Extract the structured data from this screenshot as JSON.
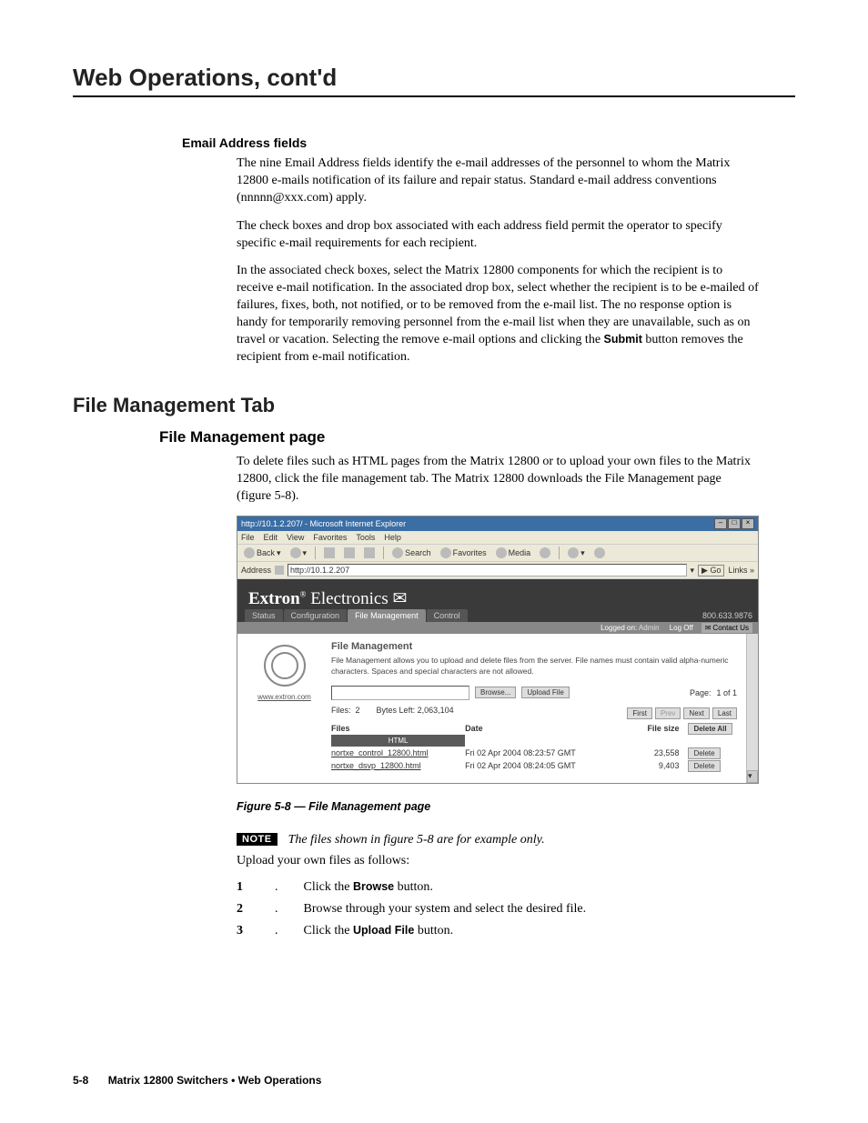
{
  "header": "Web Operations, cont'd",
  "sections": {
    "email_heading": "Email Address fields",
    "email_p1": "The nine Email Address fields identify the e-mail addresses of the personnel to whom the Matrix 12800 e-mails notification of its failure and repair status. Standard e-mail address conventions (nnnnn@xxx.com) apply.",
    "email_p2": "The check boxes and drop box associated with each address field permit the operator to specify specific e-mail requirements for each recipient.",
    "email_p3a": "In the associated check boxes, select the Matrix 12800 components for which the recipient is to receive e-mail notification.  In the associated drop box, select whether the recipient is to be e-mailed of failures, fixes, both, not notified, or to be removed from the e-mail list.  The no response option is handy for temporarily removing personnel from the e-mail list when they are unavailable, such as on travel or vacation.  Selecting the remove e-mail options and clicking the ",
    "email_p3_bold": "Submit",
    "email_p3b": " button removes the recipient from e-mail notification.",
    "fmt_h1": "File Management Tab",
    "fmp_h2": "File Management page",
    "fmp_p1": "To delete files such as HTML pages from the Matrix 12800 or to upload your own files to the Matrix 12800, click the file management tab.  The Matrix 12800 downloads the File Management page (figure 5-8)."
  },
  "screenshot": {
    "title": "http://10.1.2.207/ - Microsoft Internet Explorer",
    "menus": [
      "File",
      "Edit",
      "View",
      "Favorites",
      "Tools",
      "Help"
    ],
    "toolbar": {
      "back": "Back",
      "search": "Search",
      "favorites": "Favorites",
      "media": "Media"
    },
    "address_label": "Address",
    "address_value": "http://10.1.2.207",
    "go": "Go",
    "links": "Links",
    "brand": "Extron",
    "brand2": "Electronics",
    "tabs": [
      "Status",
      "Configuration",
      "File Management",
      "Control"
    ],
    "phone": "800.633.9876",
    "logged": "Logged on:",
    "logged_user": "Admin",
    "logoff": "Log Off",
    "contact": "Contact Us",
    "leftlink": "www.extron.com",
    "panel_title": "File Management",
    "panel_desc": "File Management allows you to upload and delete files from the server. File names must contain valid alpha-numeric characters. Spaces and special characters are not allowed.",
    "browse": "Browse...",
    "upload": "Upload File",
    "page_label": "Page:",
    "page_info": "1 of   1",
    "files_label": "Files:",
    "files_count": "2",
    "bytes_label": "Bytes Left:",
    "bytes_val": "2,063,104",
    "first": "First",
    "prev": "Prev",
    "next": "Next",
    "last": "Last",
    "cols": {
      "files": "Files",
      "date": "Date",
      "size": "File size"
    },
    "delete_all": "Delete All",
    "html_group": "HTML",
    "rows": [
      {
        "name": "nortxe_control_12800.html",
        "date": "Fri 02 Apr 2004 08:23:57 GMT",
        "size": "23,558",
        "del": "Delete"
      },
      {
        "name": "nortxe_dsvp_12800.html",
        "date": "Fri 02 Apr 2004 08:24:05 GMT",
        "size": "9,403",
        "del": "Delete"
      }
    ]
  },
  "caption": "Figure 5-8 — File Management page",
  "note_badge": "NOTE",
  "note_text": "The files shown in figure 5-8 are for example only.",
  "upload_intro": "Upload your own files as follows:",
  "steps": [
    {
      "n": "1",
      "pre": "Click the ",
      "b": "Browse",
      "post": " button."
    },
    {
      "n": "2",
      "pre": "Browse through your system and select the desired file.",
      "b": "",
      "post": ""
    },
    {
      "n": "3",
      "pre": "Click the ",
      "b": "Upload File",
      "post": " button."
    }
  ],
  "footer": {
    "page": "5-8",
    "title": "Matrix 12800 Switchers • Web Operations"
  }
}
